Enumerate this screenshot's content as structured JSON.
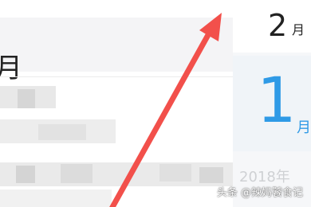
{
  "header": {
    "month_char": "月"
  },
  "right_panel": {
    "month_number": "2",
    "month_unit": "月",
    "day_number": "1",
    "day_unit": "月",
    "year_partial": "2018年"
  },
  "watermark": "头条 @辣妈饕食记",
  "colors": {
    "accent": "#2f9ae6",
    "arrow": "#f2504b",
    "header_band": "#f4f4f6",
    "right_panel_bg": "#f6f7f9"
  }
}
